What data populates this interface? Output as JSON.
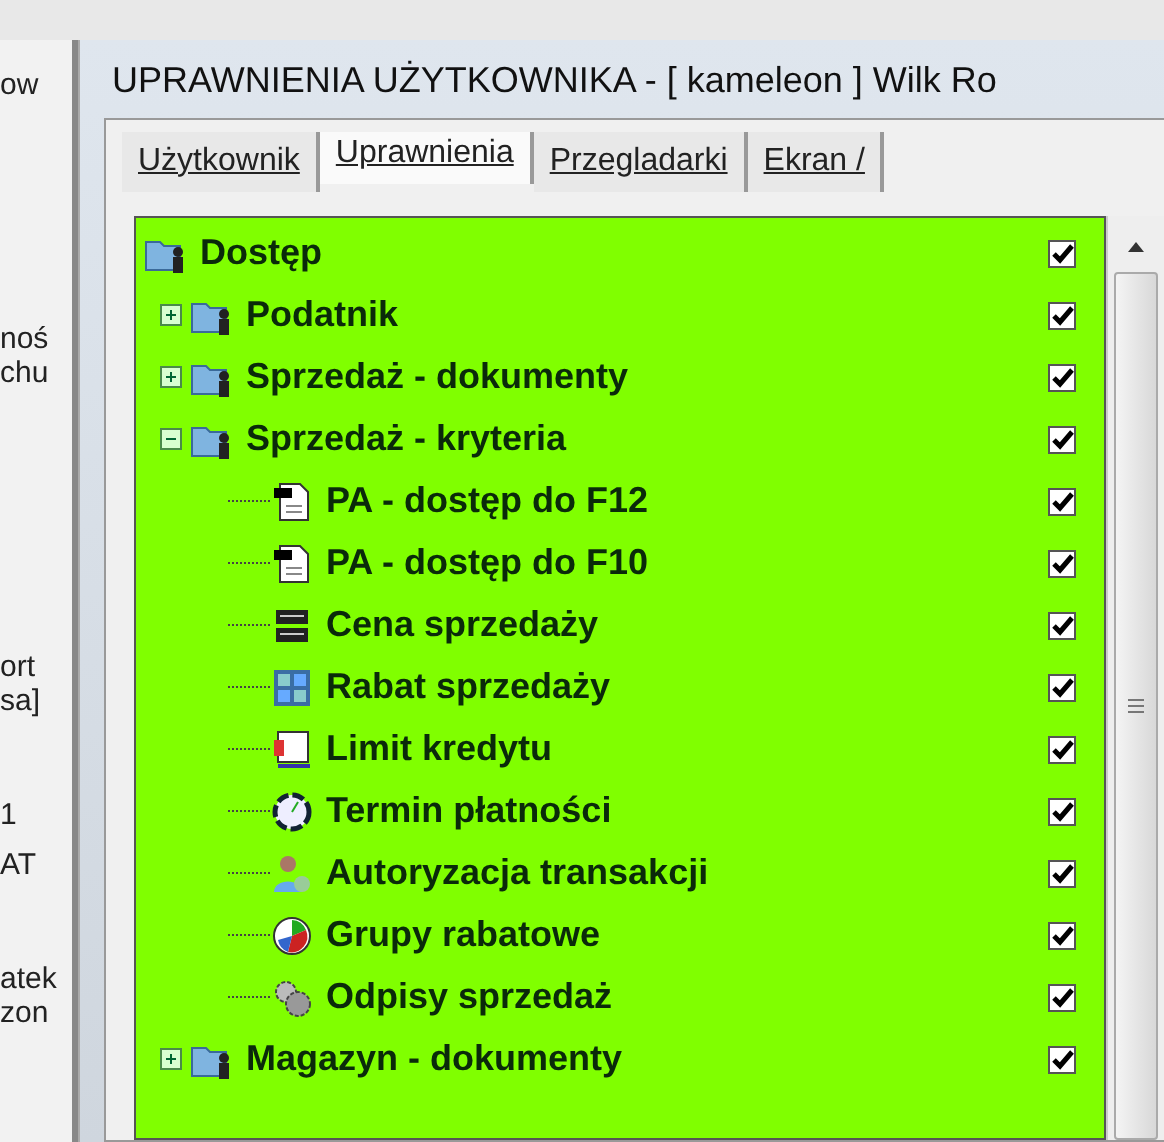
{
  "background_window": {
    "fragments": [
      "ow",
      "noś",
      "chu",
      "ort",
      "sa]",
      "1",
      "AT",
      "atek",
      "zon"
    ]
  },
  "window": {
    "title": "UPRAWNIENIA UŻYTKOWNIKA - [ kameleon ] Wilk Ro"
  },
  "tabs": [
    {
      "label": "Użytkownik",
      "selected": false
    },
    {
      "label": "Uprawnienia",
      "selected": true
    },
    {
      "label": "Przegladarki",
      "selected": false
    },
    {
      "label": "Ekran /",
      "selected": false
    }
  ],
  "tree": [
    {
      "label": "Dostęp",
      "kind": "group",
      "checked": true,
      "children": [
        {
          "label": "Podatnik",
          "kind": "group",
          "checked": true,
          "expanded": false
        },
        {
          "label": "Sprzedaż - dokumenty",
          "kind": "group",
          "checked": true,
          "expanded": false
        },
        {
          "label": "Sprzedaż - kryteria",
          "kind": "group",
          "checked": true,
          "expanded": true,
          "children": [
            {
              "label": "PA - dostęp do F12",
              "kind": "document",
              "checked": true
            },
            {
              "label": "PA - dostęp do F10",
              "kind": "document",
              "checked": true
            },
            {
              "label": "Cena sprzedaży",
              "kind": "price",
              "checked": true
            },
            {
              "label": "Rabat sprzedaży",
              "kind": "calculator",
              "checked": true
            },
            {
              "label": "Limit kredytu",
              "kind": "limit",
              "checked": true
            },
            {
              "label": "Termin płatności",
              "kind": "clock",
              "checked": true
            },
            {
              "label": "Autoryzacja transakcji",
              "kind": "person",
              "checked": true
            },
            {
              "label": "Grupy rabatowe",
              "kind": "pie",
              "checked": true
            },
            {
              "label": "Odpisy sprzedaż",
              "kind": "tools",
              "checked": true
            }
          ]
        },
        {
          "label": "Magazyn - dokumenty",
          "kind": "group",
          "checked": true,
          "expanded": false
        }
      ]
    }
  ]
}
